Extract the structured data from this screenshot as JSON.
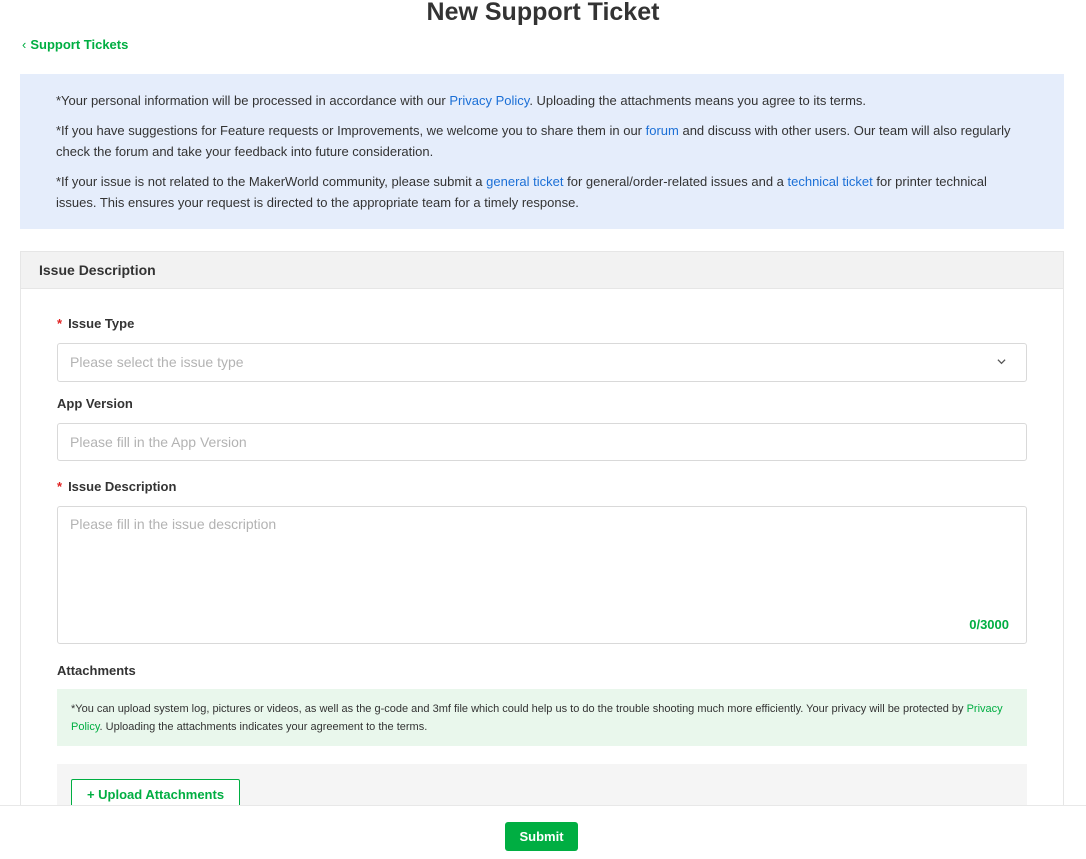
{
  "page": {
    "title": "New Support Ticket",
    "back_link": "Support Tickets"
  },
  "notice": {
    "p1_prefix": "*Your personal information will be processed in accordance with our ",
    "p1_link": "Privacy Policy",
    "p1_suffix": ". Uploading the attachments means you agree to its terms.",
    "p2_prefix": "*If you have suggestions for Feature requests or Improvements, we welcome you to share them in our ",
    "p2_link": "forum",
    "p2_suffix": " and discuss with other users. Our team will also regularly check the forum and take your feedback into future consideration.",
    "p3_prefix": "*If your issue is not related to the MakerWorld community, please submit a ",
    "p3_link1": "general ticket",
    "p3_middle": " for general/order-related issues and a ",
    "p3_link2": "technical ticket",
    "p3_suffix": " for printer technical issues. This ensures your request is directed to the appropriate team for a timely response."
  },
  "section": {
    "title": "Issue Description"
  },
  "fields": {
    "issue_type": {
      "label": "Issue Type",
      "required_mark": "*",
      "placeholder": "Please select the issue type"
    },
    "app_version": {
      "label": "App Version",
      "placeholder": "Please fill in the App Version"
    },
    "issue_description": {
      "label": "Issue Description",
      "required_mark": "*",
      "placeholder": "Please fill in the issue description",
      "counter": "0/3000"
    },
    "attachments": {
      "label": "Attachments",
      "note_prefix": "*You can upload system log, pictures or videos, as well as the g-code and 3mf file which could help us to do the trouble shooting much more efficiently. Your privacy will be protected by ",
      "note_link": "Privacy Policy",
      "note_suffix": ". Uploading the attachments indicates your agreement to the terms.",
      "upload_button": "+ Upload Attachments"
    }
  },
  "footer": {
    "submit_label": "Submit"
  },
  "colors": {
    "accent_green": "#00ae42",
    "link_blue": "#1b6fd6",
    "notice_bg": "#e5edfb",
    "attach_note_bg": "#e9f7ec",
    "required_red": "#e02020"
  },
  "icons": {
    "back": "chevron-left-icon",
    "select": "chevron-down-icon"
  }
}
